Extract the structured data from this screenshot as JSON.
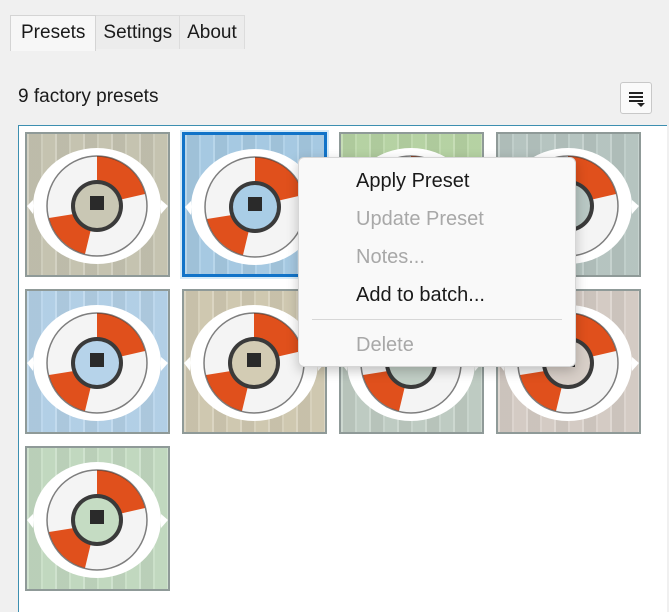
{
  "tabs": [
    {
      "label": "Presets",
      "active": true
    },
    {
      "label": "Settings",
      "active": false
    },
    {
      "label": "About",
      "active": false
    }
  ],
  "header": {
    "count_label": "9 factory presets",
    "menu_icon": "list-menu-icon"
  },
  "presets": [
    {
      "name": "preset-1",
      "tint": "#c9c7b4",
      "selected": false
    },
    {
      "name": "preset-2",
      "tint": "#a9cde6",
      "selected": true
    },
    {
      "name": "preset-3",
      "tint": "#b9d6a6",
      "selected": false
    },
    {
      "name": "preset-4",
      "tint": "#b9c8c4",
      "selected": false
    },
    {
      "name": "preset-5",
      "tint": "#b6d3ea",
      "selected": false
    },
    {
      "name": "preset-6",
      "tint": "#d3ccb4",
      "selected": false
    },
    {
      "name": "preset-7",
      "tint": "#c2cfc6",
      "selected": false
    },
    {
      "name": "preset-8",
      "tint": "#d8cfc8",
      "selected": false
    },
    {
      "name": "preset-9",
      "tint": "#c5dcc3",
      "selected": false
    }
  ],
  "context_menu": {
    "items": [
      {
        "label": "Apply Preset",
        "enabled": true
      },
      {
        "label": "Update Preset",
        "enabled": false
      },
      {
        "label": "Notes...",
        "enabled": false
      },
      {
        "label": "Add to batch...",
        "enabled": true
      },
      {
        "label": "Delete",
        "enabled": false
      }
    ]
  },
  "colors": {
    "accent": "#1173c8",
    "ring_orange": "#e0501c",
    "ring_white": "#f4f4f4"
  }
}
